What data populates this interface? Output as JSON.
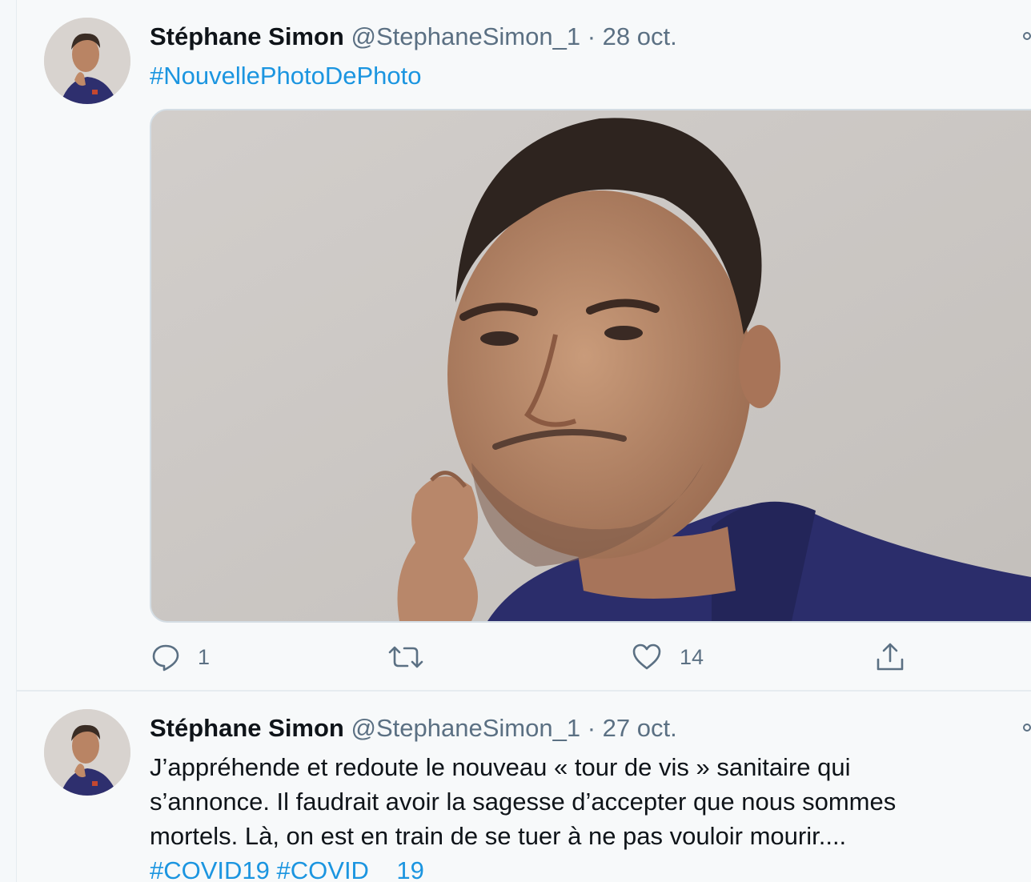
{
  "tweets": [
    {
      "author_name": "Stéphane Simon",
      "handle": "@StephaneSimon_1",
      "separator": "·",
      "date": "28 oct.",
      "hashtag": "#NouvellePhotoDePhoto",
      "has_media": true,
      "actions": {
        "reply_count": "1",
        "retweet_count": "",
        "like_count": "14"
      }
    },
    {
      "author_name": "Stéphane Simon",
      "handle": "@StephaneSimon_1",
      "separator": "·",
      "date": "27 oct.",
      "text_lines": [
        "J’appréhende et redoute le nouveau « tour de vis » sanitaire qui",
        "s’annonce. Il faudrait avoir la sagesse d’accepter que nous sommes",
        "mortels. Là, on est en train de se tuer à ne pas vouloir mourir...."
      ],
      "hashtags": [
        "#COVID19",
        "#COVID__19"
      ]
    }
  ],
  "colors": {
    "hashtag": "#1b95e0",
    "secondary_text": "#5b7083",
    "background": "#f7f9fa"
  },
  "icons": [
    "reply-icon",
    "retweet-icon",
    "like-icon",
    "share-icon",
    "more-icon"
  ]
}
